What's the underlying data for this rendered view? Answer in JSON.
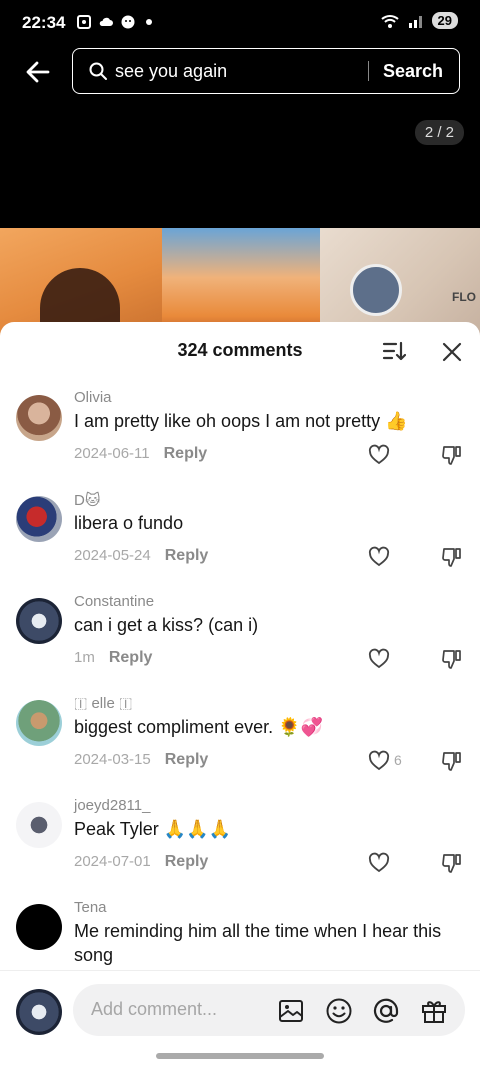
{
  "status_bar": {
    "time": "22:34",
    "battery": "29"
  },
  "search": {
    "query": "see you again",
    "button_label": "Search"
  },
  "page_counter": "2 / 2",
  "thumb_text": "FLO",
  "comments_header": {
    "title": "324 comments"
  },
  "comments": [
    {
      "user": "Olivia",
      "text": "I am pretty like oh oops I am not pretty 👍",
      "date": "2024-06-11",
      "reply": "Reply",
      "likes": ""
    },
    {
      "user": "D🐱",
      "text": "libera o fundo",
      "date": "2024-05-24",
      "reply": "Reply",
      "likes": ""
    },
    {
      "user": "Constantine",
      "text": "can i get a kiss? (can i)",
      "date": "1m",
      "reply": "Reply",
      "likes": ""
    },
    {
      "user": "🇮 elle 🇮",
      "text": "biggest compliment ever. 🌻💞",
      "date": "2024-03-15",
      "reply": "Reply",
      "likes": "6"
    },
    {
      "user": "joeyd2811_",
      "text": "Peak Tyler 🙏🙏🙏",
      "date": "2024-07-01",
      "reply": "Reply",
      "likes": ""
    },
    {
      "user": "Tena",
      "text": "Me reminding him all the time when I hear this song",
      "date": "",
      "reply": "",
      "likes": ""
    }
  ],
  "input": {
    "placeholder": "Add comment..."
  },
  "colors": {
    "sheet_bg": "#ffffff",
    "screen_bg": "#000000",
    "meta_text": "#a8a8a8"
  }
}
